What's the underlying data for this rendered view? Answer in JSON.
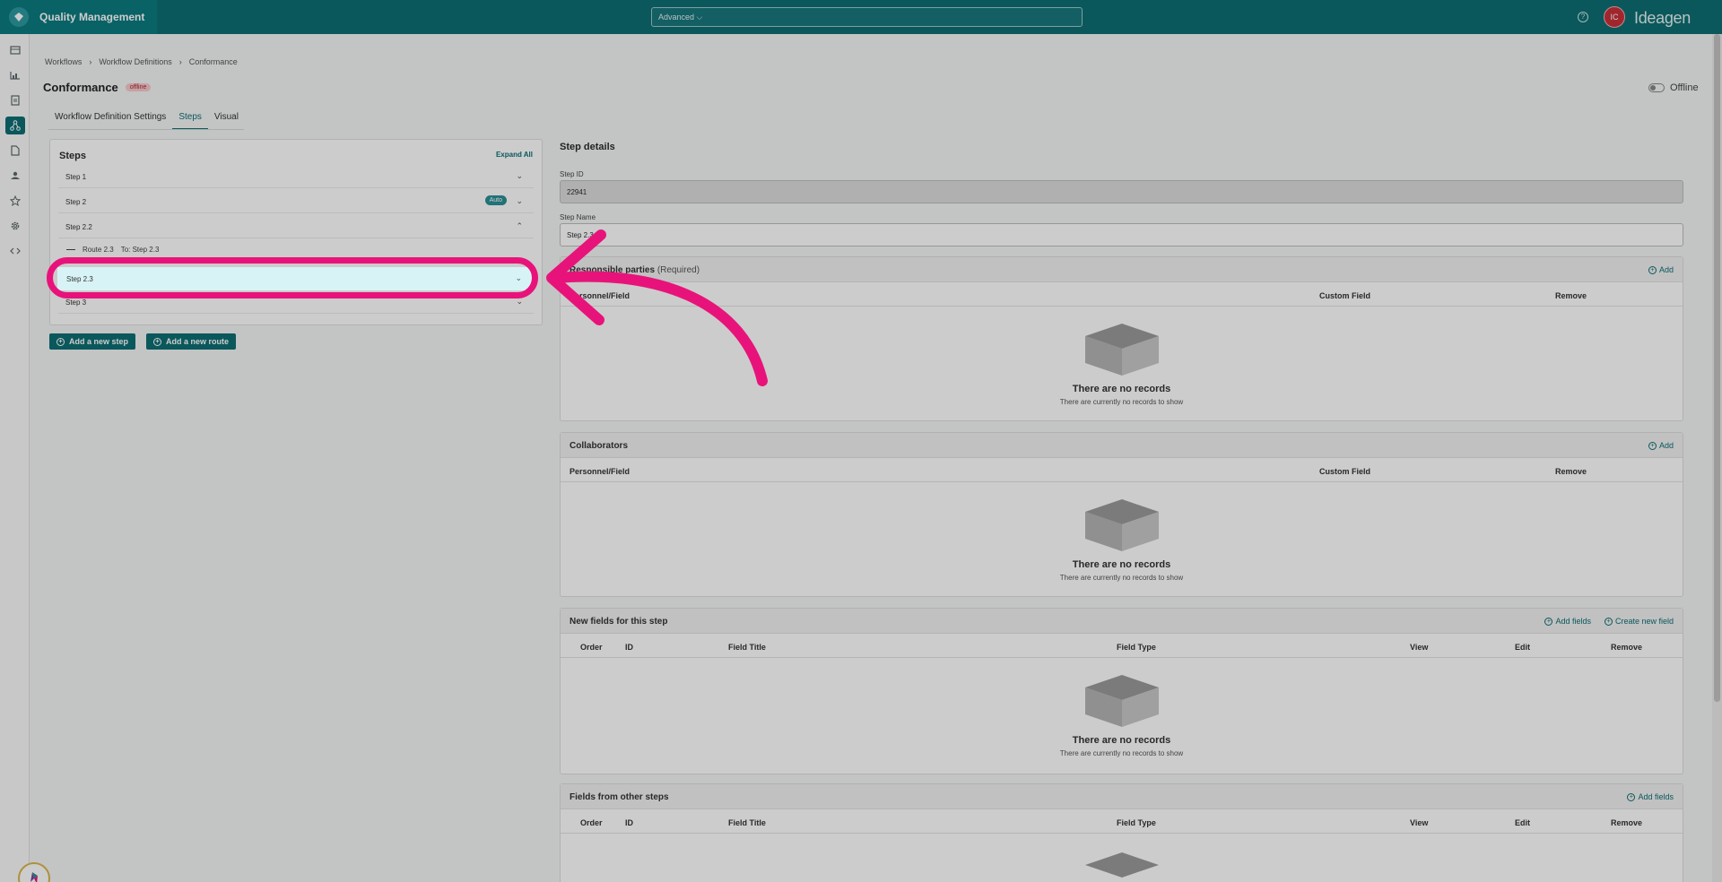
{
  "app": {
    "title": "Quality Management",
    "search_value": "Advanced ⌵",
    "user_initials": "IC",
    "brand": "Ideagen"
  },
  "breadcrumb": [
    "Workflows",
    "Workflow Definitions",
    "Conformance"
  ],
  "page": {
    "title": "Conformance",
    "status_badge": "offline",
    "toggle_label": "Offline"
  },
  "tabs": [
    {
      "label": "Workflow Definition Settings"
    },
    {
      "label": "Steps"
    },
    {
      "label": "Visual"
    }
  ],
  "steps_panel": {
    "title": "Steps",
    "expand_all": "Expand All",
    "steps": [
      {
        "label": "Step 1"
      },
      {
        "label": "Step 2",
        "badge": "Auto"
      },
      {
        "label": "Step 2.2"
      },
      {
        "label": "Step 2.3"
      },
      {
        "label": "Step 3"
      }
    ],
    "route": {
      "label": "Route 2.3",
      "to": "To: Step 2.3"
    },
    "add_step": "Add a new step",
    "add_route": "Add a new route"
  },
  "details": {
    "title": "Step details",
    "step_id_label": "Step ID",
    "step_id_value": "22941",
    "step_name_label": "Step Name",
    "step_name_value": "Step 2.3",
    "sections": {
      "responsible": {
        "title": "Responsible parties",
        "suffix": "(Required)",
        "add": "Add",
        "cols": [
          "Personnel/Field",
          "Custom Field",
          "Remove"
        ]
      },
      "collaborators": {
        "title": "Collaborators",
        "add": "Add",
        "cols": [
          "Personnel/Field",
          "Custom Field",
          "Remove"
        ]
      },
      "new_fields": {
        "title": "New fields for this step",
        "add": "Add fields",
        "create": "Create new field",
        "cols": [
          "Order",
          "ID",
          "Field Title",
          "Field Type",
          "View",
          "Edit",
          "Remove"
        ]
      },
      "other_fields": {
        "title": "Fields from other steps",
        "add": "Add fields",
        "cols": [
          "Order",
          "ID",
          "Field Title",
          "Field Type",
          "View",
          "Edit",
          "Remove"
        ]
      }
    },
    "empty_title": "There are no records",
    "empty_sub": "There are currently no records to show"
  },
  "colors": {
    "accent": "#0d6e73",
    "highlight": "#e8137a",
    "selected_row": "#d8f3f5"
  }
}
